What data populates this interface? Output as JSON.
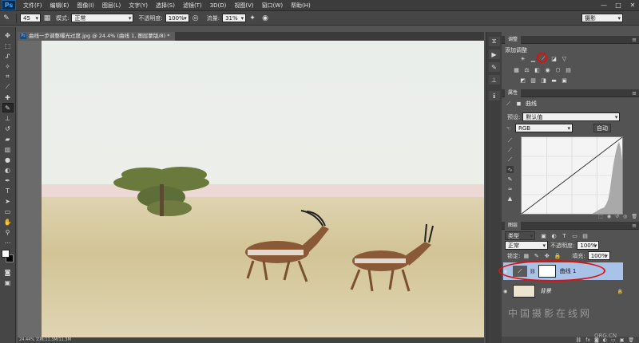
{
  "app": {
    "logo": "Ps"
  },
  "menu": [
    "文件(F)",
    "编辑(E)",
    "图像(I)",
    "图层(L)",
    "文字(Y)",
    "选择(S)",
    "滤镜(T)",
    "3D(D)",
    "视图(V)",
    "窗口(W)",
    "帮助(H)"
  ],
  "window_controls": {
    "minimize": "—",
    "maximize": "□",
    "close": "✕"
  },
  "options": {
    "brush_size": "45",
    "mode_label": "模式:",
    "mode_value": "正常",
    "opacity_label": "不透明度:",
    "opacity_value": "100%",
    "flow_label": "流量:",
    "flow_value": "31%",
    "workspace": "摄影"
  },
  "document": {
    "tab_title": "曲线一步调整曝光过度.jpg @ 24.4% (曲线 1, 图层蒙版/8) *",
    "status": "24.44%    文档:11.3M/11.3M"
  },
  "adjustments": {
    "tab": "调整",
    "add_label": "添加调整"
  },
  "properties": {
    "tab": "属性",
    "type_label": "曲线",
    "preset_label": "预设:",
    "preset_value": "默认值",
    "channel_value": "RGB",
    "auto_label": "自动",
    "curve_points": [
      [
        0,
        0
      ],
      [
        255,
        255
      ]
    ]
  },
  "layers": {
    "tab": "图层",
    "filter_label": "类型",
    "blend_mode": "正常",
    "opacity_label": "不透明度:",
    "opacity_value": "100%",
    "lock_label": "锁定:",
    "fill_label": "填充:",
    "fill_value": "100%",
    "items": [
      {
        "name": "曲线 1",
        "selected": true
      },
      {
        "name": "背景",
        "selected": false
      }
    ]
  },
  "watermark": {
    "text": "中国摄影在线网",
    "url": "ORG.CN"
  },
  "colors": {
    "accent_ring": "#dd1111",
    "selected_layer": "#a9c3e8"
  }
}
